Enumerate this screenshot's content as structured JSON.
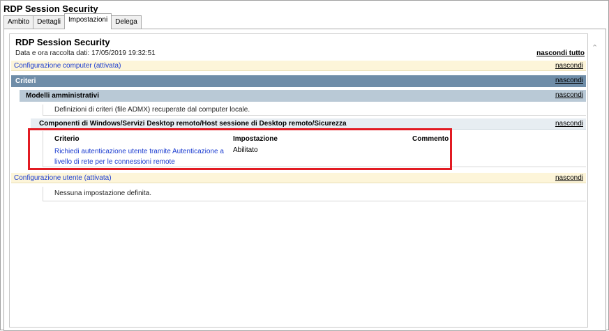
{
  "window": {
    "title": "RDP Session Security"
  },
  "tabs": [
    {
      "label": "Ambito"
    },
    {
      "label": "Dettagli"
    },
    {
      "label": "Impostazioni",
      "active": true
    },
    {
      "label": "Delega"
    }
  ],
  "report": {
    "title": "RDP Session Security",
    "date_text": "Data e ora raccolta dati: 17/05/2019 19:32:51",
    "hide_all_label": "nascondi tutto",
    "hide_label": "nascondi",
    "computer_config": "Configurazione computer (attivata)",
    "criteria": "Criteri",
    "admin_templates": "Modelli amministrativi",
    "admx_description": "Definizioni di criteri (file ADMX) recuperate dal computer locale.",
    "component_path": "Componenti di Windows/Servizi Desktop remoto/Host sessione di Desktop remoto/Sicurezza",
    "table": {
      "columns": [
        "Criterio",
        "Impostazione",
        "Commento"
      ],
      "rows": [
        {
          "criterio": "Richiedi autenticazione utente tramite Autenticazione a livello di rete per le connessioni remote",
          "impostazione": "Abilitato",
          "commento": ""
        }
      ]
    },
    "user_config": "Configurazione utente (attivata)",
    "no_settings": "Nessuna impostazione definita."
  },
  "colors": {
    "highlight": "#e21b23",
    "link": "#1a3bd0",
    "section_yellow": "#fdf5d9",
    "criteria_blue": "#6f8da8"
  }
}
